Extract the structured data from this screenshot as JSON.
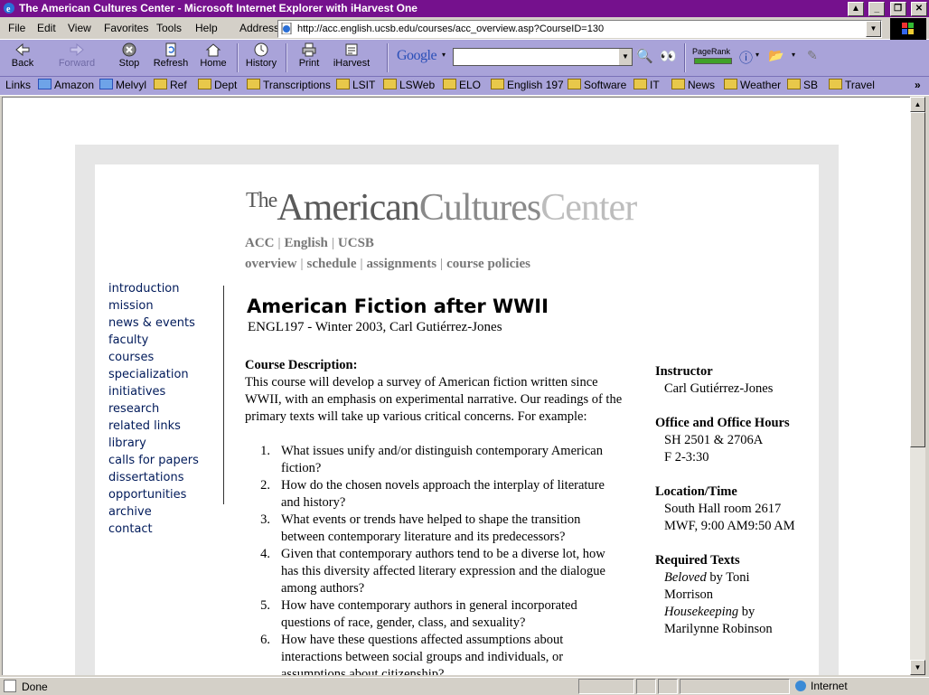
{
  "window": {
    "title": "The American Cultures Center - Microsoft Internet Explorer with iHarvest One",
    "controls": [
      "▲",
      "_",
      "❐",
      "✕"
    ]
  },
  "menubar": {
    "items": [
      "File",
      "Edit",
      "View",
      "Favorites",
      "Tools",
      "Help"
    ],
    "address_label": "Address",
    "address_url": "http://acc.english.ucsb.edu/courses/acc_overview.asp?CourseID=130"
  },
  "toolbar": {
    "buttons": [
      {
        "label": "Back",
        "icon": "back-arrow-icon"
      },
      {
        "label": "Forward",
        "icon": "forward-arrow-icon"
      },
      {
        "label": "Stop",
        "icon": "stop-icon"
      },
      {
        "label": "Refresh",
        "icon": "refresh-icon"
      },
      {
        "label": "Home",
        "icon": "home-icon"
      },
      {
        "label": "History",
        "icon": "history-icon"
      },
      {
        "label": "Print",
        "icon": "print-icon"
      },
      {
        "label": "iHarvest",
        "icon": "iharvest-icon"
      }
    ],
    "google_label": "Google",
    "pagerank_label": "PageRank"
  },
  "links": {
    "label": "Links",
    "items": [
      "Amazon",
      "Melvyl",
      "Ref",
      "Dept",
      "Transcriptions",
      "LSIT",
      "LSWeb",
      "ELO",
      "English 197",
      "Software",
      "IT",
      "News",
      "Weather",
      "SB",
      "Travel"
    ]
  },
  "page": {
    "logo": {
      "the": "The",
      "american": "American",
      "cultures": "Cultures",
      "center": "Center"
    },
    "nav1": [
      "ACC",
      "English",
      "UCSB"
    ],
    "nav2": [
      "overview",
      "schedule",
      "assignments",
      "course policies"
    ],
    "left_nav": [
      "introduction",
      "mission",
      "news & events",
      "faculty",
      "courses",
      "specialization",
      "initiatives",
      "research",
      "related links",
      "library",
      "calls for papers",
      "dissertations",
      "opportunities",
      "archive",
      "contact"
    ],
    "course_title": "American Fiction after WWII",
    "course_subtitle": "ENGL197  -  Winter 2003,  Carl Gutiérrez-Jones",
    "description_heading": "Course Description:",
    "description_text": "This course will develop a survey of American fiction written since WWII, with an emphasis on experimental narrative. Our readings of the primary texts will take up various critical concerns. For example:",
    "questions": [
      "What issues unify and/or distinguish contemporary American fiction?",
      "How do the chosen novels approach the interplay of literature and history?",
      "What events or trends have helped to shape the transition between contemporary literature and its predecessors?",
      "Given that contemporary authors tend to be a diverse lot, how has this diversity affected literary expression and the dialogue among authors?",
      "How have contemporary authors in general incorporated questions of race, gender, class, and sexuality?",
      "How have these questions affected assumptions about interactions between social groups and individuals, or assumptions about citizenship?"
    ],
    "side": {
      "instructor_h": "Instructor",
      "instructor": "Carl Gutiérrez-Jones",
      "office_h": "Office and Office Hours",
      "office_room": "SH 2501 & 2706A",
      "office_time": "F 2-3:30",
      "location_h": "Location/Time",
      "location_room": "South Hall room 2617",
      "location_time": "MWF, 9:00 AM9:50 AM",
      "texts_h": "Required Texts",
      "text1_title": "Beloved",
      "text1_author": " by Toni Morrison",
      "text2_title": "Housekeeping",
      "text2_author": " by Marilynne Robinson"
    }
  },
  "status": {
    "text": "Done",
    "zone": "Internet"
  }
}
